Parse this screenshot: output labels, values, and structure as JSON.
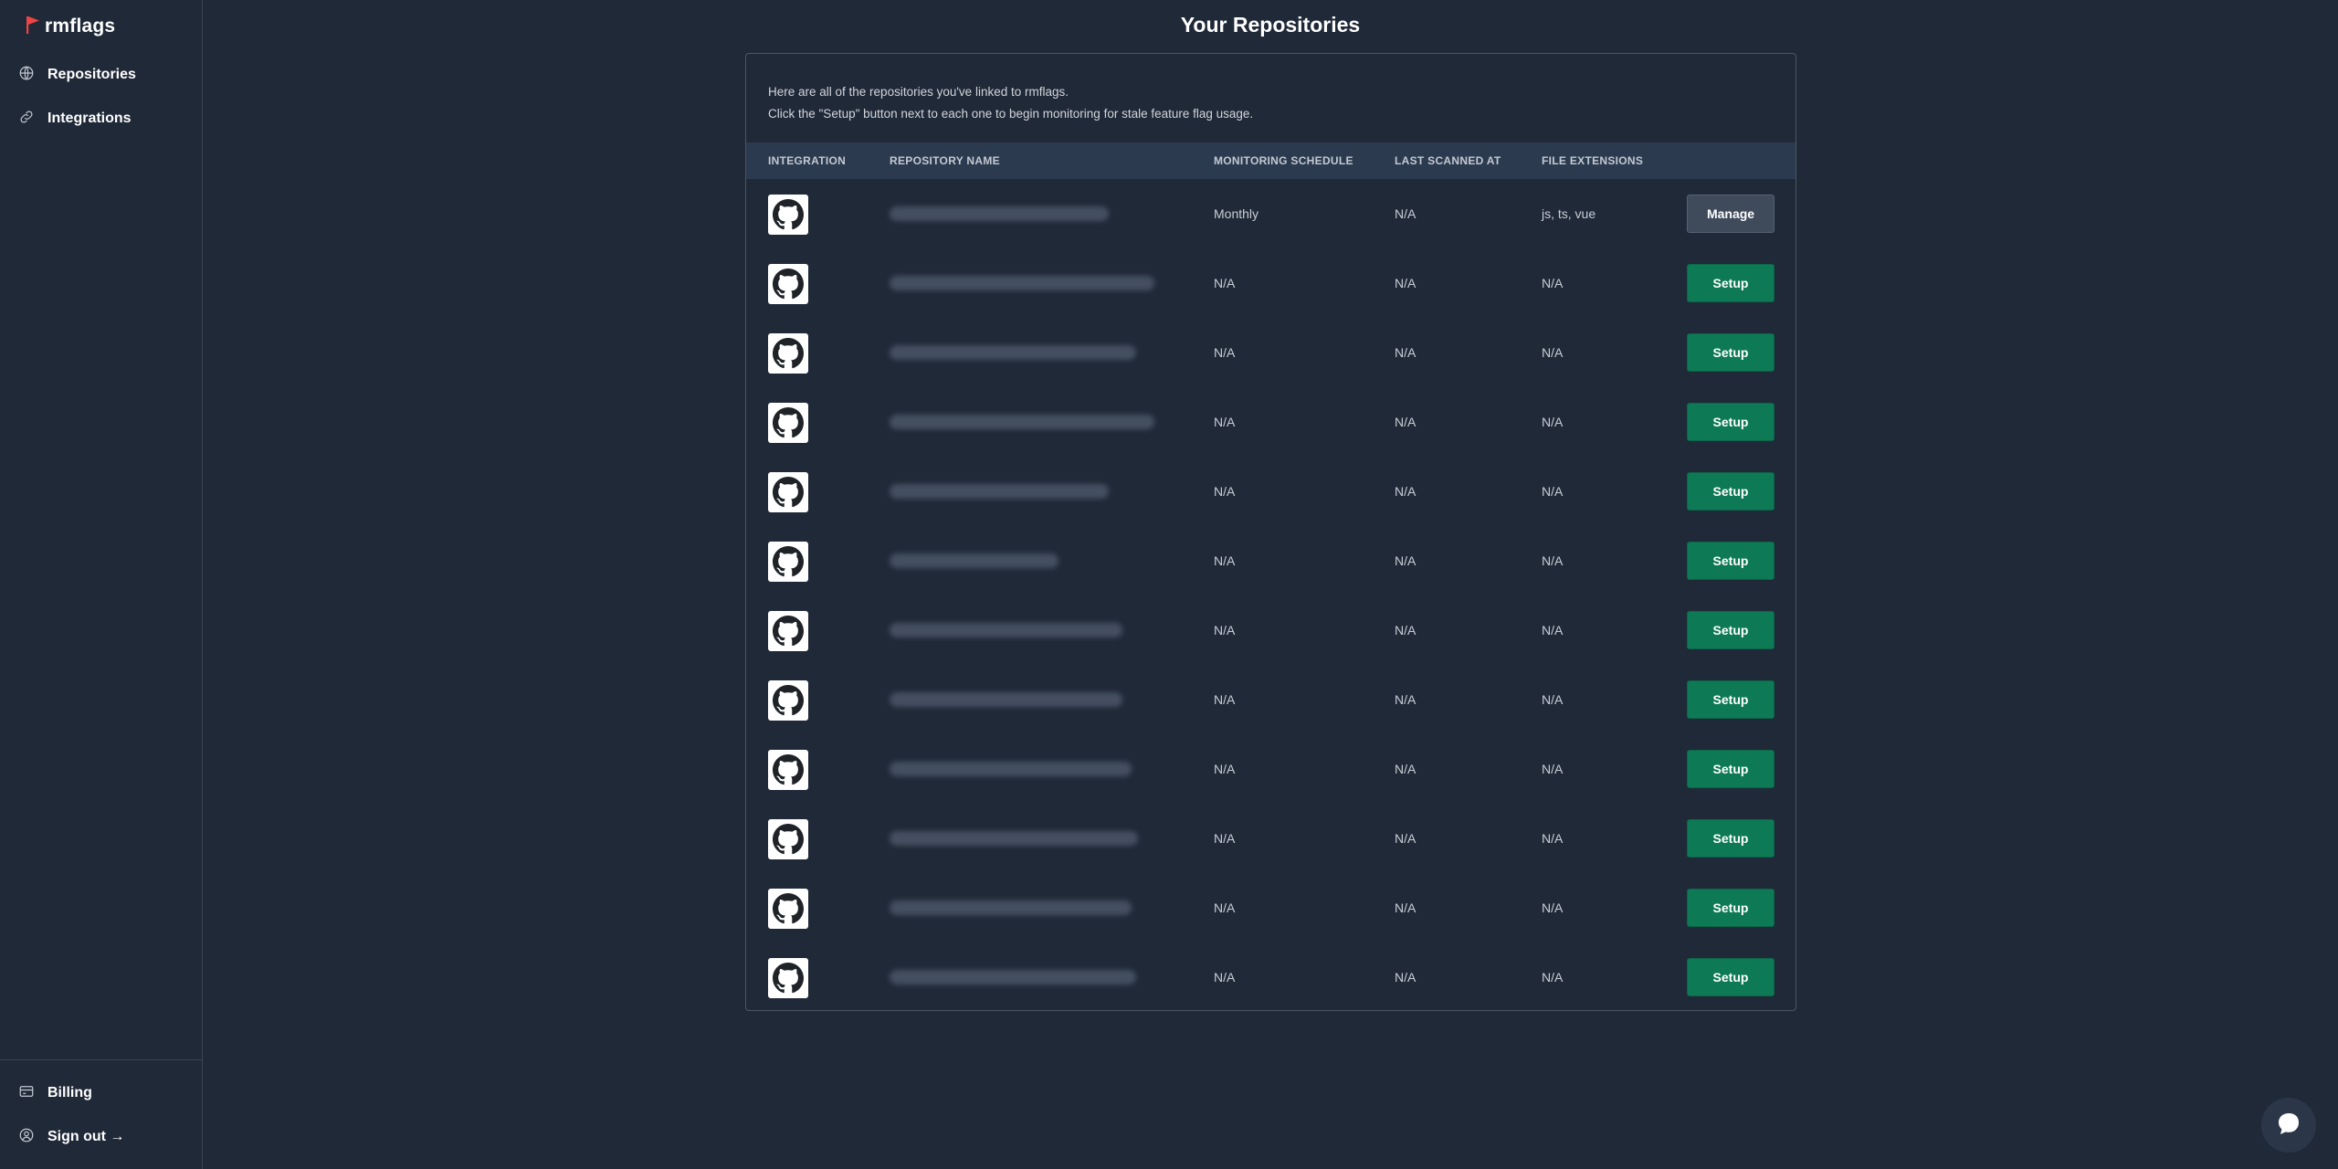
{
  "app": {
    "name": "rmflags",
    "accent": "#ef4444"
  },
  "sidebar": {
    "items": [
      {
        "label": "Repositories",
        "icon": "globe-icon"
      },
      {
        "label": "Integrations",
        "icon": "link-icon"
      }
    ],
    "bottom": [
      {
        "label": "Billing",
        "icon": "credit-card-icon"
      },
      {
        "label": "Sign out →",
        "icon": "user-circle-icon"
      }
    ]
  },
  "page": {
    "title": "Your Repositories",
    "intro_line1": "Here are all of the repositories you've linked to rmflags.",
    "intro_line2": "Click the \"Setup\" button next to each one to begin monitoring for stale feature flag usage."
  },
  "table": {
    "headers": {
      "integration": "INTEGRATION",
      "repository": "REPOSITORY NAME",
      "schedule": "MONITORING SCHEDULE",
      "scanned": "LAST SCANNED AT",
      "extensions": "FILE EXTENSIONS"
    },
    "rows": [
      {
        "integration": "github-icon",
        "schedule": "Monthly",
        "scanned": "N/A",
        "extensions": "js, ts, vue",
        "action": "Manage"
      },
      {
        "integration": "github-icon",
        "schedule": "N/A",
        "scanned": "N/A",
        "extensions": "N/A",
        "action": "Setup"
      },
      {
        "integration": "github-icon",
        "schedule": "N/A",
        "scanned": "N/A",
        "extensions": "N/A",
        "action": "Setup"
      },
      {
        "integration": "github-icon",
        "schedule": "N/A",
        "scanned": "N/A",
        "extensions": "N/A",
        "action": "Setup"
      },
      {
        "integration": "github-icon",
        "schedule": "N/A",
        "scanned": "N/A",
        "extensions": "N/A",
        "action": "Setup"
      },
      {
        "integration": "github-icon",
        "schedule": "N/A",
        "scanned": "N/A",
        "extensions": "N/A",
        "action": "Setup"
      },
      {
        "integration": "github-icon",
        "schedule": "N/A",
        "scanned": "N/A",
        "extensions": "N/A",
        "action": "Setup"
      },
      {
        "integration": "github-icon",
        "schedule": "N/A",
        "scanned": "N/A",
        "extensions": "N/A",
        "action": "Setup"
      },
      {
        "integration": "github-icon",
        "schedule": "N/A",
        "scanned": "N/A",
        "extensions": "N/A",
        "action": "Setup"
      },
      {
        "integration": "github-icon",
        "schedule": "N/A",
        "scanned": "N/A",
        "extensions": "N/A",
        "action": "Setup"
      },
      {
        "integration": "github-icon",
        "schedule": "N/A",
        "scanned": "N/A",
        "extensions": "N/A",
        "action": "Setup"
      },
      {
        "integration": "github-icon",
        "schedule": "N/A",
        "scanned": "N/A",
        "extensions": "N/A",
        "action": "Setup"
      }
    ]
  },
  "colors": {
    "background": "#202938",
    "header_row": "#2c3a4f",
    "setup_button": "#0e7a55",
    "manage_button": "#3f4a5b"
  },
  "chat": {
    "icon": "chat-bubble-icon"
  }
}
